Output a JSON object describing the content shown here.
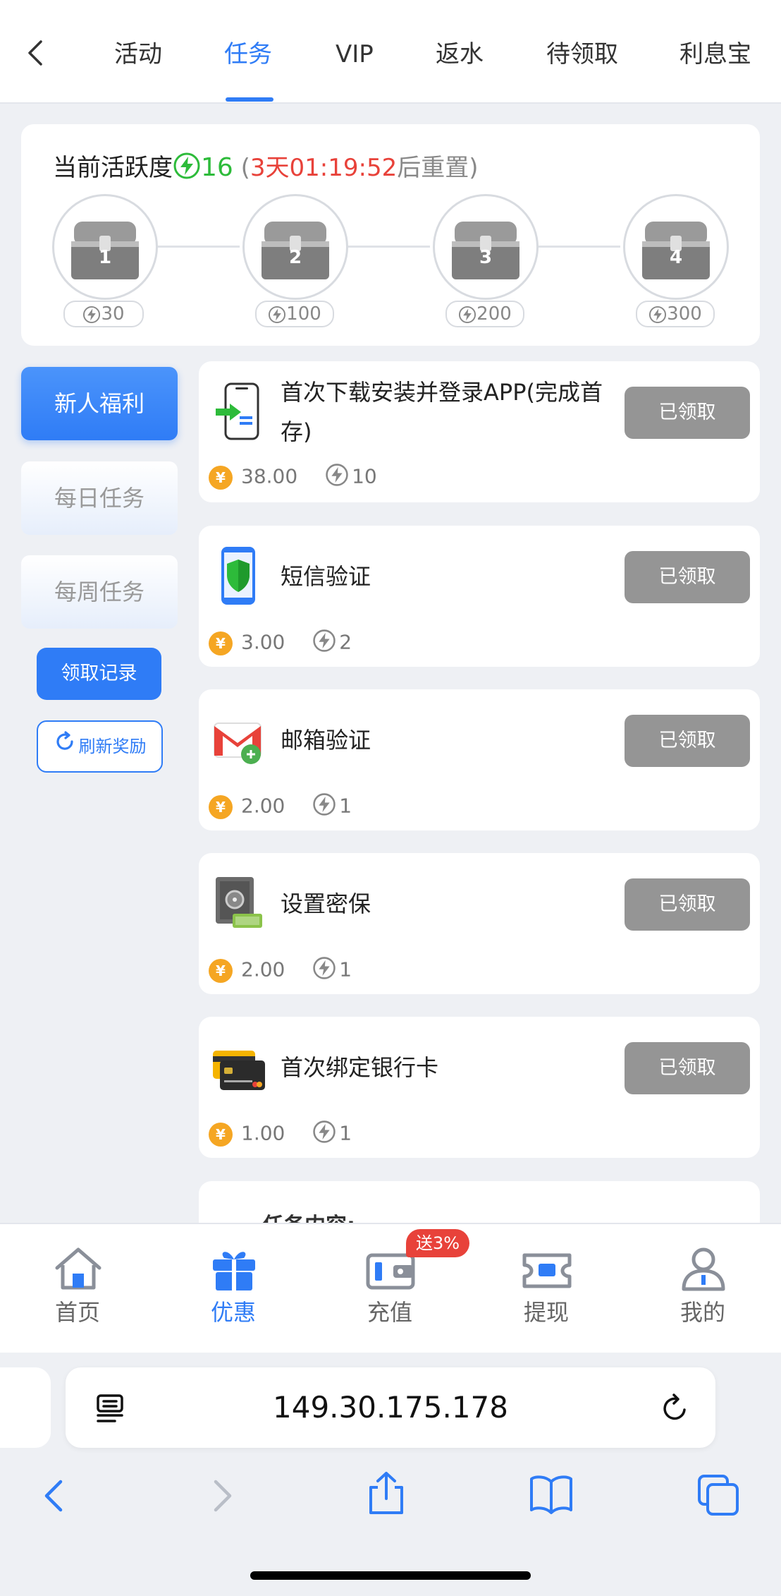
{
  "nav": {
    "tabs": [
      "活动",
      "任务",
      "VIP",
      "返水",
      "待领取",
      "利息宝"
    ],
    "active_tab": "任务"
  },
  "activity": {
    "label": "当前活跃度",
    "value": "16",
    "open_paren": "(",
    "timer": "3天01:19:52",
    "reset_suffix": "后重置)",
    "chests": [
      {
        "num": "1",
        "points": "30"
      },
      {
        "num": "2",
        "points": "100"
      },
      {
        "num": "3",
        "points": "200"
      },
      {
        "num": "4",
        "points": "300"
      }
    ]
  },
  "sidebar": {
    "items": [
      "新人福利",
      "每日任务",
      "每周任务"
    ],
    "claim_record": "领取记录",
    "refresh": "刷新奖励"
  },
  "tasks": [
    {
      "title": "首次下载安装并登录APP(完成首存)",
      "button": "已领取",
      "money": "38.00",
      "points": "10",
      "icon": "download-app-icon"
    },
    {
      "title": "短信验证",
      "button": "已领取",
      "money": "3.00",
      "points": "2",
      "icon": "phone-shield-icon"
    },
    {
      "title": "邮箱验证",
      "button": "已领取",
      "money": "2.00",
      "points": "1",
      "icon": "gmail-link-icon"
    },
    {
      "title": "设置密保",
      "button": "已领取",
      "money": "2.00",
      "points": "1",
      "icon": "safe-money-icon"
    },
    {
      "title": "首次绑定银行卡",
      "button": "已领取",
      "money": "1.00",
      "points": "1",
      "icon": "bank-card-icon"
    }
  ],
  "partial_section": "一、任务内容:",
  "bottom_nav": {
    "items": [
      "首页",
      "优惠",
      "充值",
      "提现",
      "我的"
    ],
    "active": "优惠",
    "badge": "送3%"
  },
  "browser": {
    "url": "149.30.175.178"
  },
  "colors": {
    "accent": "#2f7cf6",
    "claimed_button": "#959595",
    "timer": "#e8423a",
    "activity_value": "#2dbb3a",
    "coin": "#f5a623"
  }
}
